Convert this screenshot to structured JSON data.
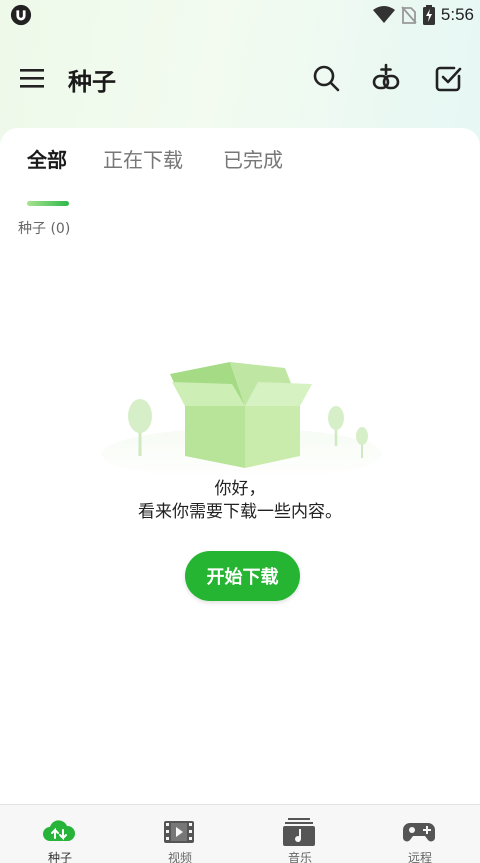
{
  "status_bar": {
    "time": "5:56"
  },
  "header": {
    "title": "种子"
  },
  "tabs": [
    {
      "label": "全部",
      "active": true
    },
    {
      "label": "正在下载",
      "active": false
    },
    {
      "label": "已完成",
      "active": false
    }
  ],
  "section": {
    "label": "种子 (0)"
  },
  "empty_state": {
    "line1": "你好，",
    "line2": "看来你需要下载一些内容。",
    "button": "开始下载"
  },
  "bottom_nav": [
    {
      "label": "种子",
      "icon": "cloud-transfer-icon",
      "active": true
    },
    {
      "label": "视频",
      "icon": "film-icon",
      "active": false
    },
    {
      "label": "音乐",
      "icon": "music-icon",
      "active": false
    },
    {
      "label": "远程",
      "icon": "gamepad-icon",
      "active": false
    }
  ],
  "colors": {
    "accent": "#25b532",
    "tab_gradient_start": "#a9e38f",
    "tab_gradient_end": "#2db84a"
  }
}
